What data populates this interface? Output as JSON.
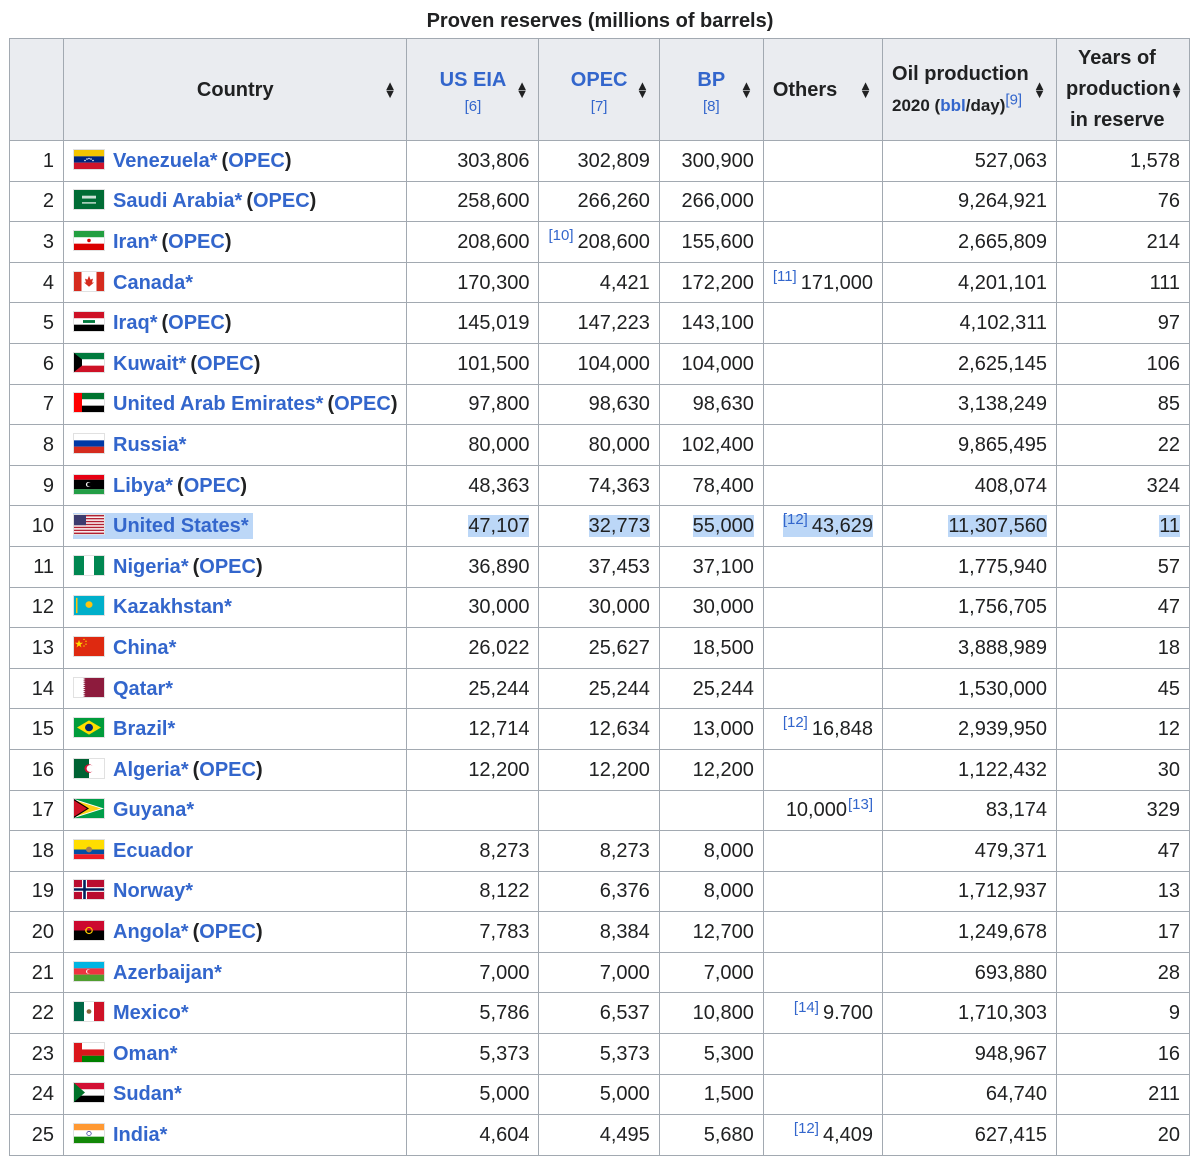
{
  "caption": "Proven reserves (millions of barrels)",
  "headers": {
    "country": "Country",
    "us_eia": "US EIA",
    "us_eia_ref": "[6]",
    "opec": "OPEC",
    "opec_ref": "[7]",
    "bp": "BP",
    "bp_ref": "[8]",
    "others": "Others",
    "production_line1": "Oil production",
    "production_line2_pre": "2020 (",
    "production_line2_link": "bbl",
    "production_line2_post": "/day)",
    "production_ref": "[9]",
    "years_line1": "Years of",
    "years_line2": "production",
    "years_line3": "in reserve",
    "sort_glyph_up": "▲",
    "sort_glyph_down": "▼"
  },
  "rows": [
    {
      "rank": "1",
      "flag": "venezuela",
      "country": "Venezuela",
      "star": "*",
      "opec": "OPEC",
      "us_eia": "303,806",
      "opec_val": "302,809",
      "bp": "300,900",
      "others_note": "",
      "others": "",
      "others_note_after": "",
      "production": "527,063",
      "years": "1,578",
      "note_col": "",
      "highlight": false
    },
    {
      "rank": "2",
      "flag": "saudi-arabia",
      "country": "Saudi Arabia",
      "star": "*",
      "opec": "OPEC",
      "us_eia": "258,600",
      "opec_val": "266,260",
      "bp": "266,000",
      "others_note": "",
      "others": "",
      "others_note_after": "",
      "production": "9,264,921",
      "years": "76",
      "note_col": "",
      "highlight": false
    },
    {
      "rank": "3",
      "flag": "iran",
      "country": "Iran",
      "star": "*",
      "opec": "OPEC",
      "us_eia": "208,600",
      "opec_val": "208,600",
      "opec_note": "[10]",
      "bp": "155,600",
      "others_note": "",
      "others": "",
      "others_note_after": "",
      "production": "2,665,809",
      "years": "214",
      "highlight": false
    },
    {
      "rank": "4",
      "flag": "canada",
      "country": "Canada",
      "star": "*",
      "opec": "",
      "us_eia": "170,300",
      "opec_val": "4,421",
      "bp": "172,200",
      "others_note": "[11]",
      "others": "171,000",
      "others_note_after": "",
      "production": "4,201,101",
      "years": "111",
      "highlight": false
    },
    {
      "rank": "5",
      "flag": "iraq",
      "country": "Iraq",
      "star": "*",
      "opec": "OPEC",
      "us_eia": "145,019",
      "opec_val": "147,223",
      "bp": "143,100",
      "others_note": "",
      "others": "",
      "others_note_after": "",
      "production": "4,102,311",
      "years": "97",
      "highlight": false
    },
    {
      "rank": "6",
      "flag": "kuwait",
      "country": "Kuwait",
      "star": "*",
      "opec": "OPEC",
      "us_eia": "101,500",
      "opec_val": "104,000",
      "bp": "104,000",
      "others_note": "",
      "others": "",
      "others_note_after": "",
      "production": "2,625,145",
      "years": "106",
      "highlight": false
    },
    {
      "rank": "7",
      "flag": "uae",
      "country": "United Arab Emirates",
      "star": "*",
      "opec": "OPEC",
      "us_eia": "97,800",
      "opec_val": "98,630",
      "bp": "98,630",
      "others_note": "",
      "others": "",
      "others_note_after": "",
      "production": "3,138,249",
      "years": "85",
      "highlight": false
    },
    {
      "rank": "8",
      "flag": "russia",
      "country": "Russia",
      "star": "*",
      "opec": "",
      "us_eia": "80,000",
      "opec_val": "80,000",
      "bp": "102,400",
      "others_note": "",
      "others": "",
      "others_note_after": "",
      "production": "9,865,495",
      "years": "22",
      "highlight": false
    },
    {
      "rank": "9",
      "flag": "libya",
      "country": "Libya",
      "star": "*",
      "opec": "OPEC",
      "us_eia": "48,363",
      "opec_val": "74,363",
      "bp": "78,400",
      "others_note": "",
      "others": "",
      "others_note_after": "",
      "production": "408,074",
      "years": "324",
      "highlight": false
    },
    {
      "rank": "10",
      "flag": "united-states",
      "country": "United States",
      "star": "*",
      "opec": "",
      "us_eia": "47,107",
      "opec_val": "32,773",
      "bp": "55,000",
      "others_note": "[12]",
      "others": "43,629",
      "others_note_after": "",
      "production": "11,307,560",
      "years": "11",
      "highlight": true
    },
    {
      "rank": "11",
      "flag": "nigeria",
      "country": "Nigeria",
      "star": "*",
      "opec": "OPEC",
      "us_eia": "36,890",
      "opec_val": "37,453",
      "bp": "37,100",
      "others_note": "",
      "others": "",
      "others_note_after": "",
      "production": "1,775,940",
      "years": "57",
      "highlight": false
    },
    {
      "rank": "12",
      "flag": "kazakhstan",
      "country": "Kazakhstan",
      "star": "*",
      "opec": "",
      "us_eia": "30,000",
      "opec_val": "30,000",
      "bp": "30,000",
      "others_note": "",
      "others": "",
      "others_note_after": "",
      "production": "1,756,705",
      "years": "47",
      "highlight": false
    },
    {
      "rank": "13",
      "flag": "china",
      "country": "China",
      "star": "*",
      "opec": "",
      "us_eia": "26,022",
      "opec_val": "25,627",
      "bp": "18,500",
      "others_note": "",
      "others": "",
      "others_note_after": "",
      "production": "3,888,989",
      "years": "18",
      "highlight": false
    },
    {
      "rank": "14",
      "flag": "qatar",
      "country": "Qatar",
      "star": "*",
      "opec": "",
      "us_eia": "25,244",
      "opec_val": "25,244",
      "bp": "25,244",
      "others_note": "",
      "others": "",
      "others_note_after": "",
      "production": "1,530,000",
      "years": "45",
      "highlight": false
    },
    {
      "rank": "15",
      "flag": "brazil",
      "country": "Brazil",
      "star": "*",
      "opec": "",
      "us_eia": "12,714",
      "opec_val": "12,634",
      "bp": "13,000",
      "others_note": "[12]",
      "others": "16,848",
      "others_note_after": "",
      "production": "2,939,950",
      "years": "12",
      "highlight": false
    },
    {
      "rank": "16",
      "flag": "algeria",
      "country": "Algeria",
      "star": "*",
      "opec": "OPEC",
      "us_eia": "12,200",
      "opec_val": "12,200",
      "bp": "12,200",
      "others_note": "",
      "others": "",
      "others_note_after": "",
      "production": "1,122,432",
      "years": "30",
      "highlight": false
    },
    {
      "rank": "17",
      "flag": "guyana",
      "country": "Guyana",
      "star": "*",
      "opec": "",
      "us_eia": "",
      "opec_val": "",
      "bp": "",
      "others_note": "",
      "others": "10,000",
      "others_note_after": "[13]",
      "production": "83,174",
      "years": "329",
      "highlight": false
    },
    {
      "rank": "18",
      "flag": "ecuador",
      "country": "Ecuador",
      "star": "",
      "opec": "",
      "us_eia": "8,273",
      "opec_val": "8,273",
      "bp": "8,000",
      "others_note": "",
      "others": "",
      "others_note_after": "",
      "production": "479,371",
      "years": "47",
      "highlight": false
    },
    {
      "rank": "19",
      "flag": "norway",
      "country": "Norway",
      "star": "*",
      "opec": "",
      "us_eia": "8,122",
      "opec_val": "6,376",
      "bp": "8,000",
      "others_note": "",
      "others": "",
      "others_note_after": "",
      "production": "1,712,937",
      "years": "13",
      "highlight": false
    },
    {
      "rank": "20",
      "flag": "angola",
      "country": "Angola",
      "star": "*",
      "opec": "OPEC",
      "us_eia": "7,783",
      "opec_val": "8,384",
      "bp": "12,700",
      "others_note": "",
      "others": "",
      "others_note_after": "",
      "production": "1,249,678",
      "years": "17",
      "highlight": false
    },
    {
      "rank": "21",
      "flag": "azerbaijan",
      "country": "Azerbaijan",
      "star": "*",
      "opec": "",
      "us_eia": "7,000",
      "opec_val": "7,000",
      "bp": "7,000",
      "others_note": "",
      "others": "",
      "others_note_after": "",
      "production": "693,880",
      "years": "28",
      "highlight": false
    },
    {
      "rank": "22",
      "flag": "mexico",
      "country": "Mexico",
      "star": "*",
      "opec": "",
      "us_eia": "5,786",
      "opec_val": "6,537",
      "bp": "10,800",
      "others_note": "[14]",
      "others": "9.700",
      "others_note_after": "",
      "production": "1,710,303",
      "years": "9",
      "highlight": false
    },
    {
      "rank": "23",
      "flag": "oman",
      "country": "Oman",
      "star": "*",
      "opec": "",
      "us_eia": "5,373",
      "opec_val": "5,373",
      "bp": "5,300",
      "others_note": "",
      "others": "",
      "others_note_after": "",
      "production": "948,967",
      "years": "16",
      "highlight": false
    },
    {
      "rank": "24",
      "flag": "sudan",
      "country": "Sudan",
      "star": "*",
      "opec": "",
      "us_eia": "5,000",
      "opec_val": "5,000",
      "bp": "1,500",
      "others_note": "",
      "others": "",
      "others_note_after": "",
      "production": "64,740",
      "years": "211",
      "highlight": false
    },
    {
      "rank": "25",
      "flag": "india",
      "country": "India",
      "star": "*",
      "opec": "",
      "us_eia": "4,604",
      "opec_val": "4,495",
      "bp": "5,680",
      "others_note": "[12]",
      "others": "4,409",
      "others_note_after": "",
      "production": "627,415",
      "years": "20",
      "highlight": false
    }
  ],
  "colors": {
    "link": "#3366cc",
    "header_bg": "#eaecf0",
    "border": "#a2a9b1",
    "highlight": "#bcd7f7"
  }
}
